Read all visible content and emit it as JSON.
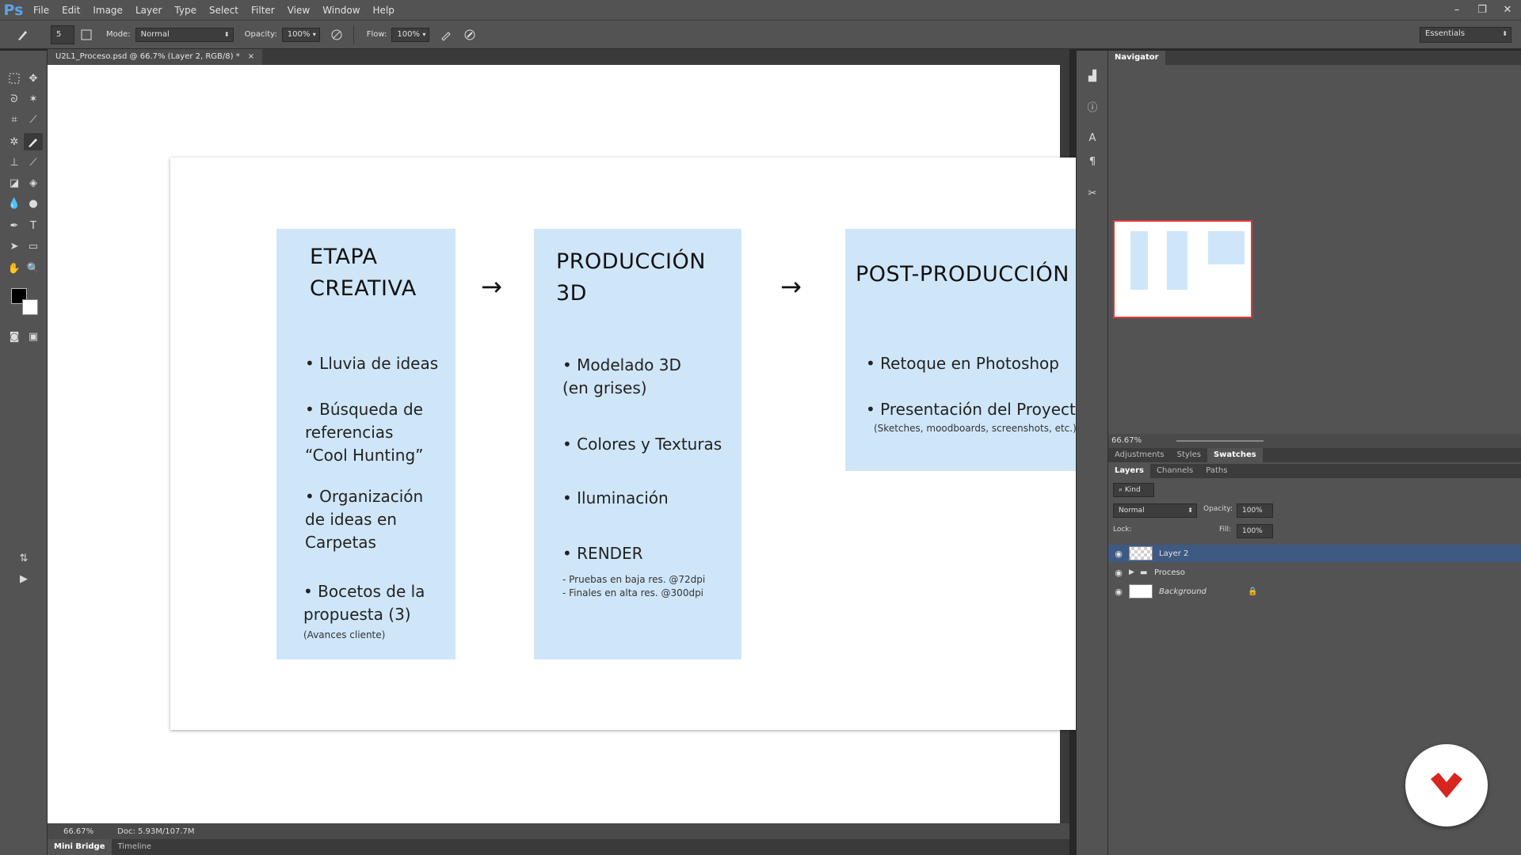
{
  "app": {
    "logo": "Ps",
    "workspace": "Essentials"
  },
  "menu": [
    "File",
    "Edit",
    "Image",
    "Layer",
    "Type",
    "Select",
    "Filter",
    "View",
    "Window",
    "Help"
  ],
  "window_controls": [
    "–",
    "❐",
    "✕"
  ],
  "options": {
    "brush_size": "5",
    "mode_label": "Mode:",
    "mode_value": "Normal",
    "opacity_label": "Opacity:",
    "opacity_value": "100%",
    "flow_label": "Flow:",
    "flow_value": "100%"
  },
  "document": {
    "tab_title": "U2L1_Proceso.psd @ 66.7% (Layer 2, RGB/8) *",
    "close": "×"
  },
  "slide": {
    "col1": {
      "title": [
        "ETAPA",
        "CREATIVA"
      ],
      "bullets": [
        "• Lluvia de ideas",
        "• Búsqueda de",
        "referencias",
        "“Cool Hunting”",
        "• Organización",
        "de ideas en",
        "Carpetas",
        "• Bocetos de la",
        "propuesta (3)"
      ],
      "note": "(Avances cliente)"
    },
    "col2": {
      "title": [
        "PRODUCCIÓN",
        "3D"
      ],
      "bullets": [
        "• Modelado 3D",
        "(en grises)",
        "• Colores y Texturas",
        "• Iluminación",
        "• RENDER"
      ],
      "notes": [
        "- Pruebas en baja res. @72dpi",
        "- Finales en alta res. @300dpi"
      ]
    },
    "col3": {
      "title": "POST-PRODUCCIÓN",
      "bullets": [
        "• Retoque en Photoshop",
        "• Presentación del Proyecto"
      ],
      "note": "(Sketches, moodboards, screenshots, etc.)"
    },
    "arrow": "→"
  },
  "status": {
    "zoom": "66.67%",
    "doc": "Doc: 5.93M/107.7M"
  },
  "bottom_tabs": [
    "Mini Bridge",
    "Timeline"
  ],
  "panels": {
    "navigator": {
      "title": "Navigator",
      "zoom": "66.67%"
    },
    "adjust_tabs": [
      "Adjustments",
      "Styles",
      "Swatches"
    ],
    "layer_tabs": [
      "Layers",
      "Channels",
      "Paths"
    ],
    "kind_label": "Kind",
    "blend_mode": "Normal",
    "opacity_label": "Opacity:",
    "opacity_value": "100%",
    "lock_label": "Lock:",
    "fill_label": "Fill:",
    "fill_value": "100%",
    "layers": [
      {
        "name": "Layer 2"
      },
      {
        "name": "Proceso"
      },
      {
        "name": "Background"
      }
    ]
  },
  "colors": {
    "accent_red": "#d7261e",
    "slide_block": "#cfe6f8",
    "selection_blue": "#3e5a83"
  }
}
